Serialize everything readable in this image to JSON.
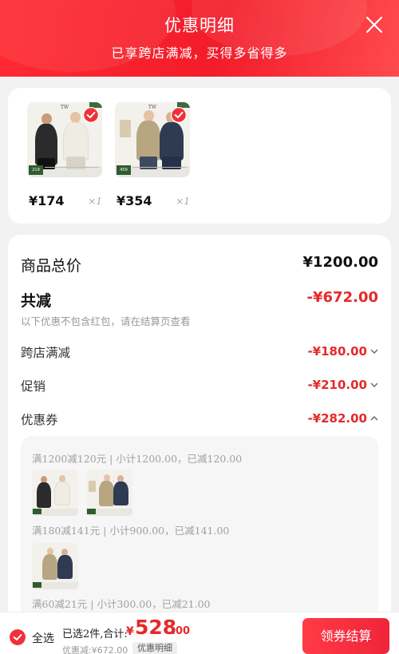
{
  "header": {
    "title": "优惠明细",
    "subtitle": "已享跨店满减，买得多省得多",
    "close_icon": "close-icon"
  },
  "products": [
    {
      "price": "¥174",
      "qty": "×1",
      "tag": "219"
    },
    {
      "price": "¥354",
      "qty": "×1",
      "tag": "459"
    }
  ],
  "summary": {
    "total_label": "商品总价",
    "total_value": "¥1200.00",
    "reduce_label": "共减",
    "reduce_value": "-¥672.00",
    "note": "以下优惠不包含红包，请在结算页查看",
    "lines": [
      {
        "label": "跨店满减",
        "value": "-¥180.00",
        "chevron": "chevron-down-icon"
      },
      {
        "label": "促销",
        "value": "-¥210.00",
        "chevron": "chevron-down-icon"
      },
      {
        "label": "优惠券",
        "value": "-¥282.00",
        "chevron": "chevron-up-icon"
      }
    ]
  },
  "coupons": [
    {
      "text": "满1200减120元 | 小计1200.00，已减120.00"
    },
    {
      "text": "满180减141元 | 小计900.00，已减141.00"
    },
    {
      "text": "满60减21元 | 小计300.00，已减21.00"
    }
  ],
  "bottom_bar": {
    "select_all": "全选",
    "selected_text": "已选2件,合计:",
    "price_symbol": "¥",
    "price_int": "528",
    "price_dec": ".00",
    "discount_text": "优惠减:¥672.00",
    "detail_chip": "优惠明细",
    "checkout": "领券结算"
  },
  "colors": {
    "accent": "#e52a2a",
    "header_bg": "#f21c2a"
  }
}
